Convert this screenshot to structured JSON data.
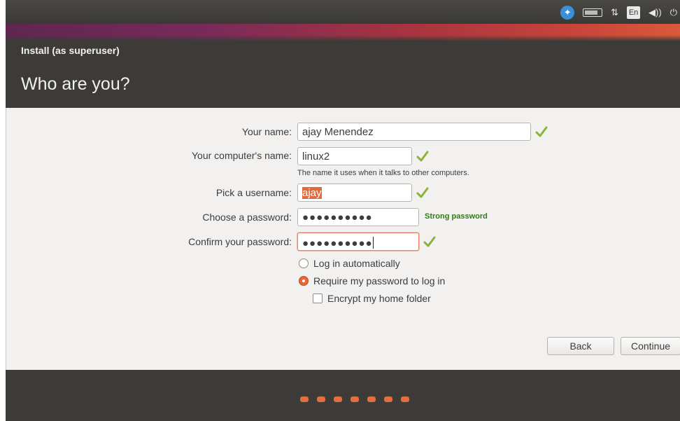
{
  "top_panel": {
    "indicators": [
      {
        "icon": "accessibility-icon",
        "glyph": "✦"
      },
      {
        "icon": "battery-icon",
        "glyph": ""
      },
      {
        "icon": "network-icon",
        "glyph": "⇅"
      },
      {
        "icon": "keyboard-layout-icon",
        "glyph": "En"
      },
      {
        "icon": "volume-icon",
        "glyph": "◀))"
      },
      {
        "icon": "power-icon",
        "glyph": "⏻"
      }
    ]
  },
  "window": {
    "title": "Install (as superuser)",
    "page_title": "Who are you?"
  },
  "form": {
    "your_name": {
      "label": "Your name:",
      "value": "ajay Menendez"
    },
    "computer_name": {
      "label": "Your computer's name:",
      "value": "linux2",
      "hint": "The name it uses when it talks to other computers."
    },
    "username": {
      "label": "Pick a username:",
      "value": "ajay"
    },
    "password": {
      "label": "Choose a password:",
      "value": "●●●●●●●●●●",
      "strength": "Strong password"
    },
    "confirm_password": {
      "label": "Confirm your password:",
      "value": "●●●●●●●●●●"
    },
    "login_options": {
      "auto": "Log in automatically",
      "require": "Require my password to log in",
      "selected": "require"
    },
    "encrypt_home": {
      "label": "Encrypt my home folder",
      "checked": false
    }
  },
  "buttons": {
    "back": "Back",
    "continue": "Continue"
  },
  "progress": {
    "steps": 7
  },
  "colors": {
    "accent": "#e2703e",
    "valid_check": "#8bb33c",
    "strength_text": "#2e7d10",
    "dark_bg": "#3c3b37"
  }
}
